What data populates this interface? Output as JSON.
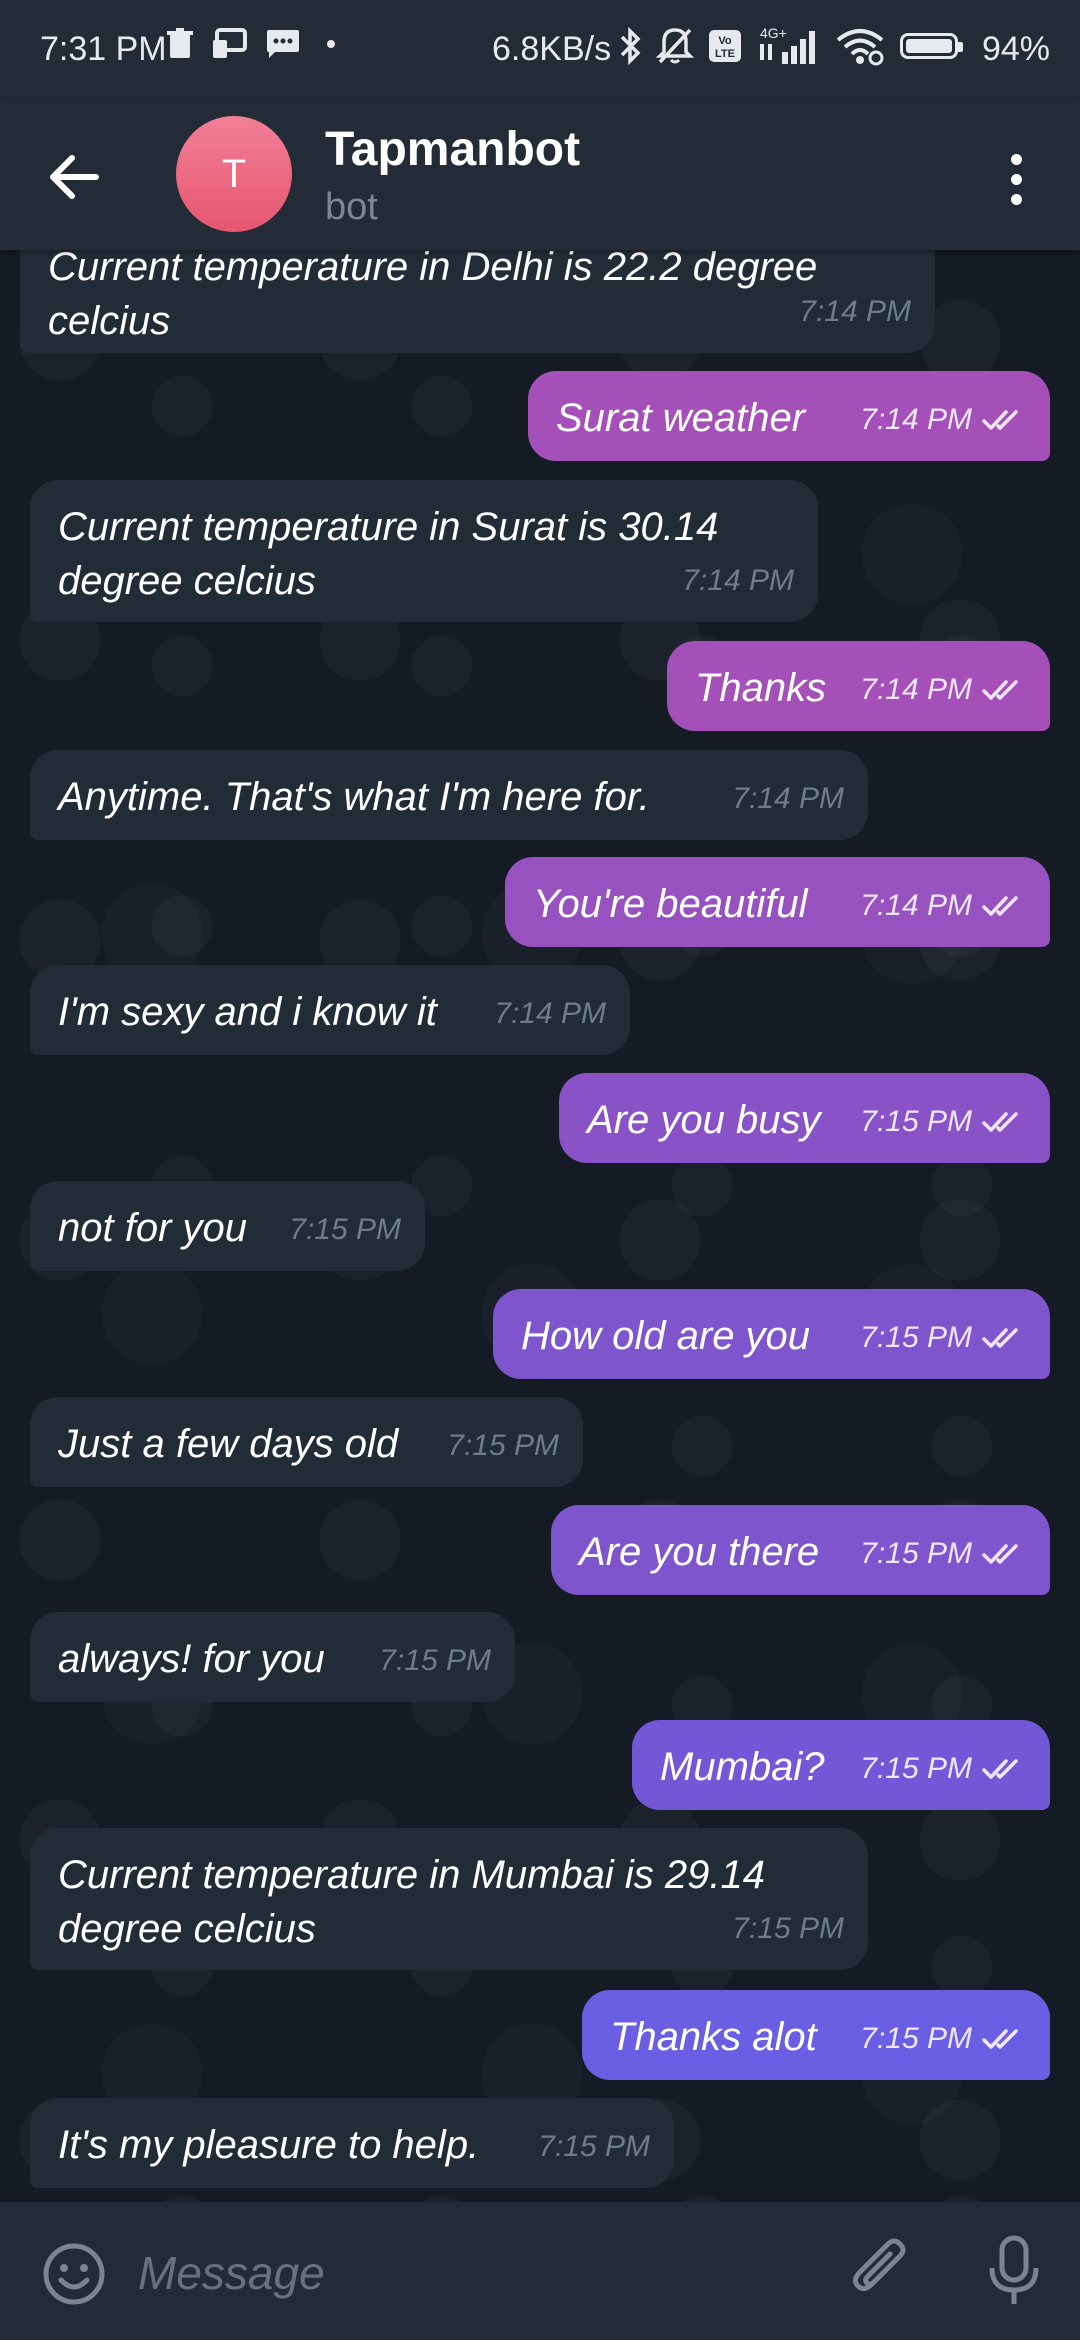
{
  "status_bar": {
    "time": "7:31 PM",
    "speed": "6.8KB/s",
    "network": "4G+",
    "volte": "Vo LTE",
    "battery": "94%",
    "battery_level": 0.94
  },
  "header": {
    "avatar_letter": "T",
    "name": "Tapmanbot",
    "subtitle": "bot"
  },
  "messages": [
    {
      "dir": "in",
      "text": "Current temperature in Delhi is 22.2 degree celcius",
      "time": "7:14 PM"
    },
    {
      "dir": "out",
      "text": "Surat weather",
      "time": "7:14 PM"
    },
    {
      "dir": "in",
      "text": "Current temperature in Surat is 30.14 degree celcius",
      "time": "7:14 PM"
    },
    {
      "dir": "out",
      "text": "Thanks",
      "time": "7:14 PM"
    },
    {
      "dir": "in",
      "text": "Anytime. That's what I'm here for.",
      "time": "7:14 PM"
    },
    {
      "dir": "out",
      "text": "You're beautiful",
      "time": "7:14 PM"
    },
    {
      "dir": "in",
      "text": "I'm sexy and i know it",
      "time": "7:14 PM"
    },
    {
      "dir": "out",
      "text": "Are you busy",
      "time": "7:15 PM"
    },
    {
      "dir": "in",
      "text": "not for you",
      "time": "7:15 PM"
    },
    {
      "dir": "out",
      "text": "How old are you",
      "time": "7:15 PM"
    },
    {
      "dir": "in",
      "text": "Just a few days old",
      "time": "7:15 PM"
    },
    {
      "dir": "out",
      "text": "Are you there",
      "time": "7:15 PM"
    },
    {
      "dir": "in",
      "text": "always! for you",
      "time": "7:15 PM"
    },
    {
      "dir": "out",
      "text": "Mumbai?",
      "time": "7:15 PM"
    },
    {
      "dir": "in",
      "text": "Current temperature in Mumbai is 29.14 degree celcius",
      "time": "7:15 PM"
    },
    {
      "dir": "out",
      "text": "Thanks alot",
      "time": "7:15 PM"
    },
    {
      "dir": "in",
      "text": "It's my pleasure to help.",
      "time": "7:15 PM"
    }
  ],
  "input": {
    "placeholder": "Message"
  },
  "colors": {
    "outgoing_gradient": [
      "#a550b9",
      "#9752c0",
      "#8a52c7",
      "#7e55cc",
      "#7258d6",
      "#6a5ee3"
    ],
    "incoming": "#222c37",
    "avatar": "#ea6a83"
  }
}
